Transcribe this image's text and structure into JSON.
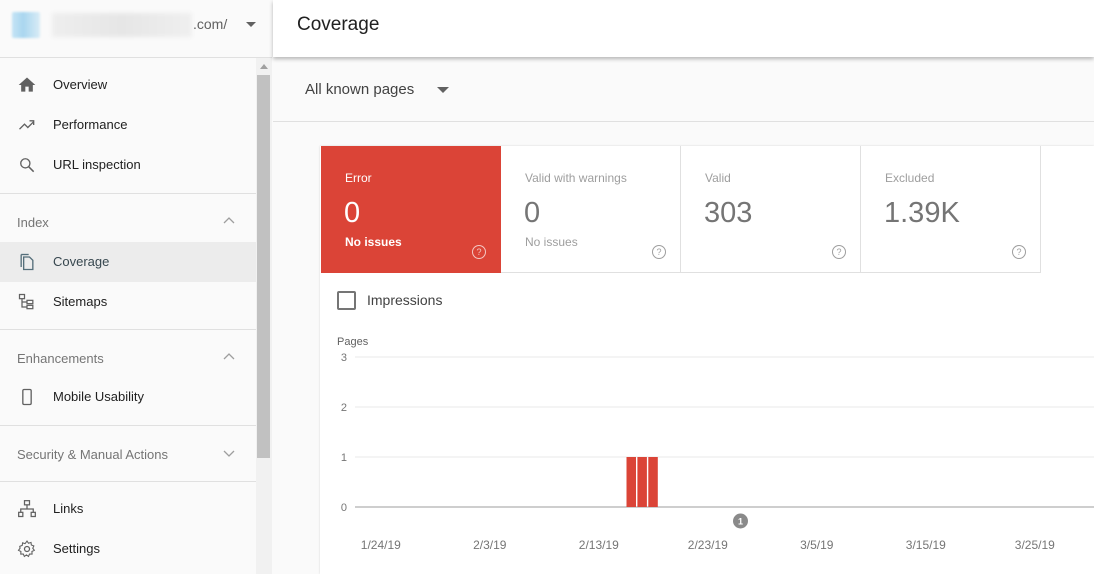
{
  "property": {
    "url_suffix": ".com/",
    "dropdown_icon": "caret-down-icon"
  },
  "sidebar": {
    "top_items": [
      {
        "label": "Overview",
        "icon": "home-icon"
      },
      {
        "label": "Performance",
        "icon": "trending-up-icon"
      },
      {
        "label": "URL inspection",
        "icon": "search-icon"
      }
    ],
    "sections": [
      {
        "label": "Index",
        "expanded": true,
        "items": [
          {
            "label": "Coverage",
            "icon": "copy-pages-icon",
            "active": true
          },
          {
            "label": "Sitemaps",
            "icon": "sitemap-icon",
            "active": false
          }
        ]
      },
      {
        "label": "Enhancements",
        "expanded": true,
        "items": [
          {
            "label": "Mobile Usability",
            "icon": "smartphone-icon",
            "active": false
          }
        ]
      },
      {
        "label": "Security & Manual Actions",
        "expanded": false,
        "items": []
      }
    ],
    "bottom_items": [
      {
        "label": "Links",
        "icon": "links-icon"
      },
      {
        "label": "Settings",
        "icon": "settings-icon"
      }
    ]
  },
  "header": {
    "title": "Coverage"
  },
  "filter": {
    "selected": "All known pages"
  },
  "cards": [
    {
      "title": "Error",
      "value": "0",
      "sub": "No issues",
      "selected": true,
      "color": "#db4437"
    },
    {
      "title": "Valid with warnings",
      "value": "0",
      "sub": "No issues",
      "selected": false
    },
    {
      "title": "Valid",
      "value": "303",
      "sub": "",
      "selected": false
    },
    {
      "title": "Excluded",
      "value": "1.39K",
      "sub": "",
      "selected": false
    }
  ],
  "help_glyph": "?",
  "impressions": {
    "label": "Impressions",
    "checked": false
  },
  "chart_data": {
    "type": "bar",
    "title": "",
    "ylabel": "Pages",
    "xlabel": "",
    "ylim": [
      0,
      3
    ],
    "yticks": [
      0,
      1,
      2,
      3
    ],
    "x_range": [
      "1/22/19",
      "3/31/19"
    ],
    "xtick_labels": [
      "1/24/19",
      "2/3/19",
      "2/13/19",
      "2/23/19",
      "3/5/19",
      "3/15/19",
      "3/25/19"
    ],
    "series": [
      {
        "name": "Error",
        "color": "#db4437",
        "points": [
          {
            "date": "2/16/19",
            "value": 1
          },
          {
            "date": "2/17/19",
            "value": 1
          },
          {
            "date": "2/18/19",
            "value": 1
          }
        ]
      }
    ],
    "annotations": [
      {
        "date": "2/26/19",
        "label": "1"
      }
    ],
    "grid": true
  }
}
